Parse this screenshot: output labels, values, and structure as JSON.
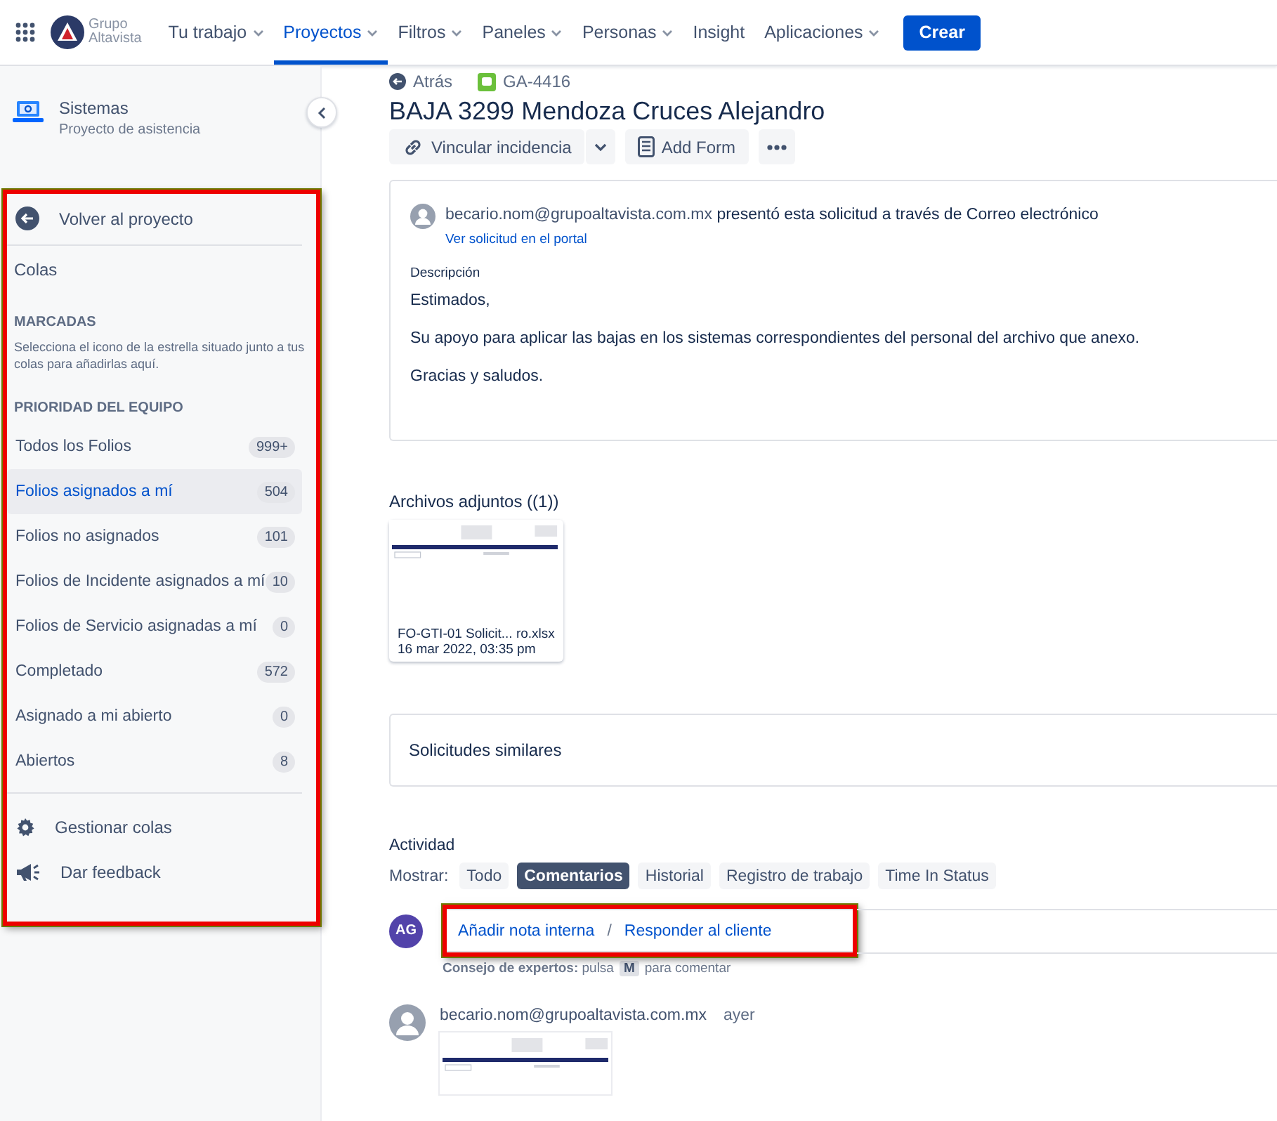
{
  "logo": {
    "line1": "Grupo",
    "line2": "Altavista"
  },
  "nav_items": [
    {
      "label": "Tu trabajo",
      "dropdown": true,
      "selected": false
    },
    {
      "label": "Proyectos",
      "dropdown": true,
      "selected": true
    },
    {
      "label": "Filtros",
      "dropdown": true,
      "selected": false
    },
    {
      "label": "Paneles",
      "dropdown": true,
      "selected": false
    },
    {
      "label": "Personas",
      "dropdown": true,
      "selected": false
    },
    {
      "label": "Insight",
      "dropdown": false,
      "selected": false
    },
    {
      "label": "Aplicaciones",
      "dropdown": true,
      "selected": false
    }
  ],
  "create_button": "Crear",
  "project": {
    "name": "Sistemas",
    "type": "Proyecto de asistencia"
  },
  "sidebar": {
    "back": "Volver al proyecto",
    "queues_title": "Colas",
    "starred_heading": "MARCADAS",
    "starred_hint": "Selecciona el icono de la estrella situado junto a tus colas para añadirlas aquí.",
    "team_heading": "PRIORIDAD DEL EQUIPO",
    "queues": [
      {
        "label": "Todos los Folios",
        "count": "999+",
        "selected": false
      },
      {
        "label": "Folios asignados a mí",
        "count": "504",
        "selected": true
      },
      {
        "label": "Folios no asignados",
        "count": "101",
        "selected": false
      },
      {
        "label": "Folios de Incidente asignados a mí",
        "count": "10",
        "selected": false
      },
      {
        "label": "Folios de Servicio asignadas a mí",
        "count": "0",
        "selected": false
      },
      {
        "label": "Completado",
        "count": "572",
        "selected": false
      },
      {
        "label": "Asignado a mi abierto",
        "count": "0",
        "selected": false
      },
      {
        "label": "Abiertos",
        "count": "8",
        "selected": false
      }
    ],
    "footer": [
      {
        "label": "Gestionar colas",
        "kind": "settings"
      },
      {
        "label": "Dar feedback",
        "kind": "feedback"
      }
    ]
  },
  "issue": {
    "back": "Atrás",
    "key": "GA-4416",
    "title": "BAJA 3299 Mendoza Cruces Alejandro",
    "actions": [
      {
        "label": "Vincular incidencia",
        "kind": "link"
      },
      {
        "kind": "caret"
      },
      {
        "label": "Add Form",
        "kind": "form"
      },
      {
        "kind": "more"
      }
    ],
    "request": {
      "reporter": "becario.nom@grupoaltavista.com.mx",
      "via": "presentó esta solicitud a través de",
      "channel": "Correo electrónico",
      "portal_link": "Ver solicitud en el portal",
      "description_label": "Descripción",
      "paragraphs": [
        "Estimados,",
        "Su apoyo para aplicar las bajas en los sistemas correspondientes del personal del archivo que anexo.",
        "Gracias y saludos."
      ]
    },
    "attachments": {
      "title": "Archivos adjuntos ((1))",
      "files": [
        {
          "name": "FO-GTI-01 Solicit... ro.xlsx",
          "date": "16 mar 2022, 03:35 pm"
        }
      ]
    },
    "similar": "Solicitudes similares",
    "activity": {
      "title": "Actividad",
      "show_label": "Mostrar:",
      "filters": [
        {
          "label": "Todo",
          "selected": false
        },
        {
          "label": "Comentarios",
          "selected": true
        },
        {
          "label": "Historial",
          "selected": false
        },
        {
          "label": "Registro de trabajo",
          "selected": false
        },
        {
          "label": "Time In Status",
          "selected": false
        }
      ],
      "avatar": "AG",
      "internal_note": "Añadir nota interna",
      "separator": "/",
      "reply": "Responder al cliente",
      "tip": "**Consejo de expertos:** pulsa",
      "tip_key": "M",
      "tip_end": "para comentar",
      "comments": [
        {
          "author": "becario.nom@grupoaltavista.com.mx",
          "time": "ayer"
        }
      ]
    }
  }
}
